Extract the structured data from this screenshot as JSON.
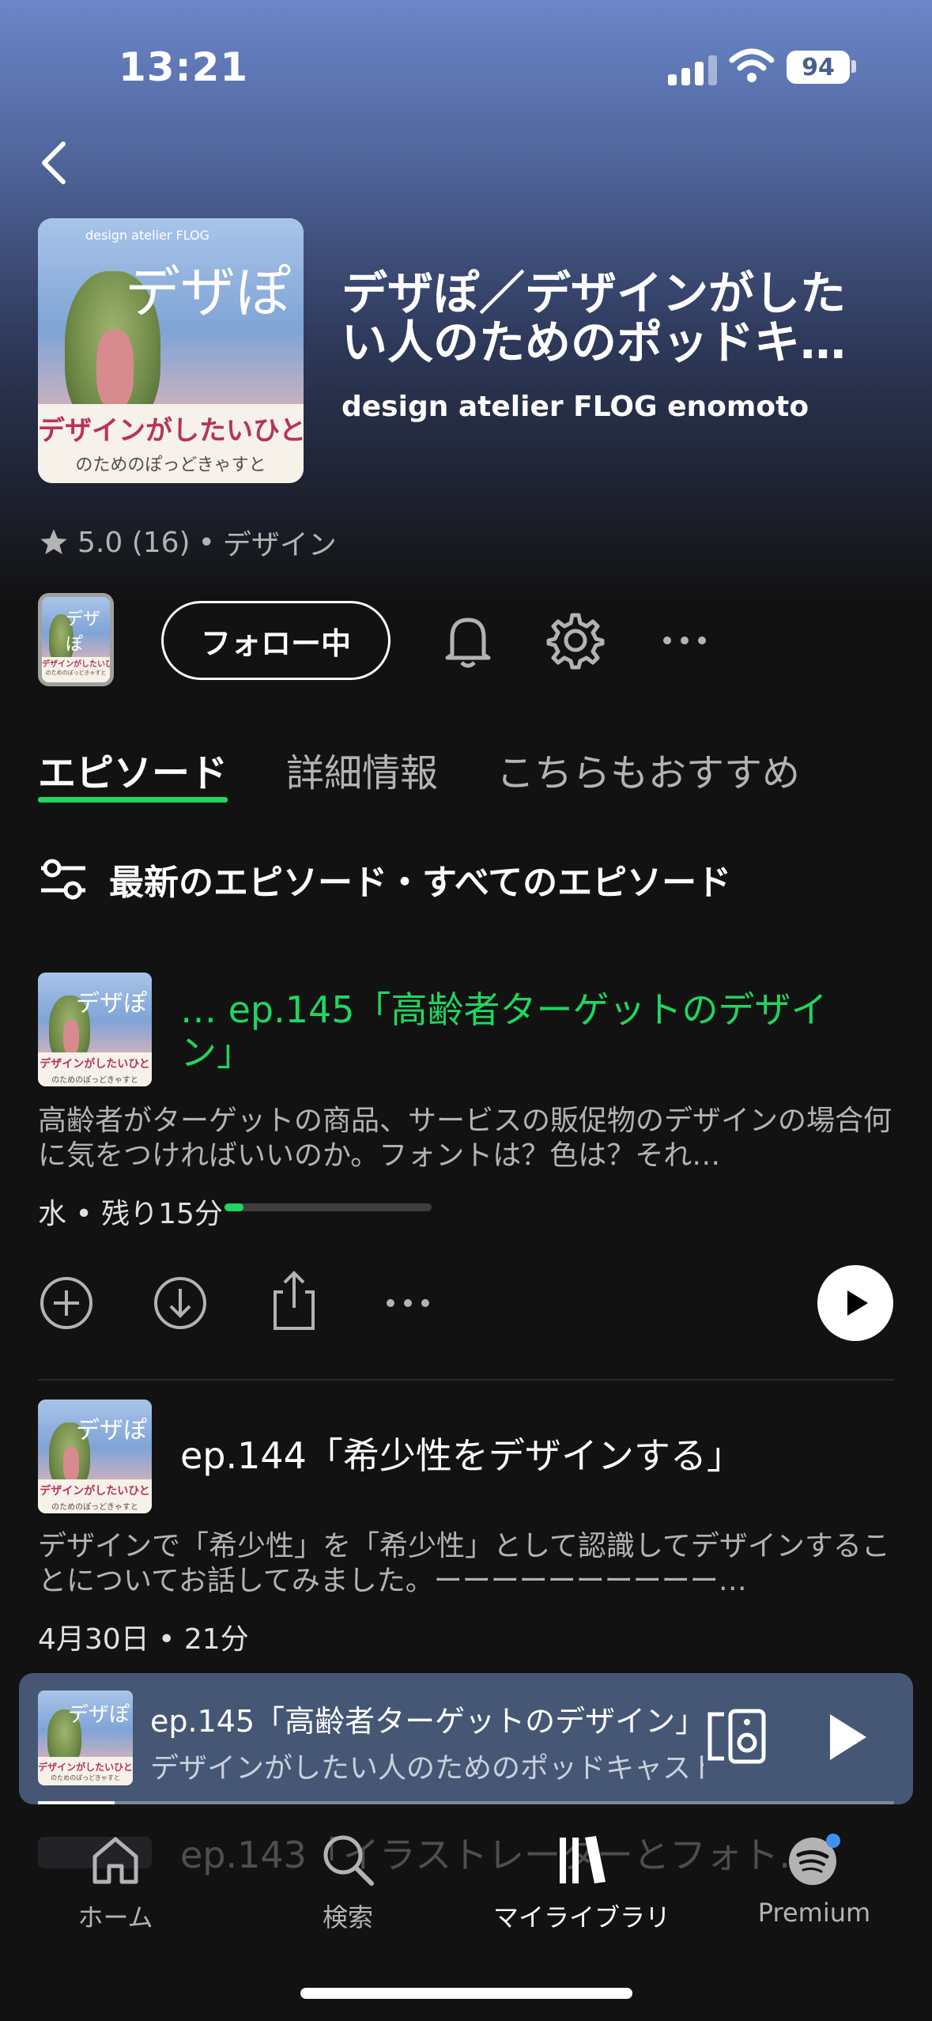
{
  "status_bar": {
    "time": "13:21",
    "battery": "94"
  },
  "podcast": {
    "title": "デザぽ／デザインがしたい人のためのポッドキ…",
    "author": "design atelier FLOG enomoto",
    "rating": "5.0 (16)",
    "separator": "•",
    "category": "デザイン",
    "follow_label": "フォロー中"
  },
  "cover_art": {
    "brand": "design atelier FLOG",
    "main": "デザぽ",
    "line1": "デザインがしたいひと",
    "line2": "のためのぽっどきゃすと"
  },
  "tabs": [
    {
      "label": "エピソード"
    },
    {
      "label": "詳細情報"
    },
    {
      "label": "こちらもおすすめ"
    }
  ],
  "filter_label": "最新のエピソード・すべてのエピソード",
  "episodes": [
    {
      "title": "… ep.145「高齢者ターゲットのデザイン」",
      "description": "高齢者がターゲットの商品、サービスの販促物のデザインの場合何に気をつければいいのか。フォントは？色は？それ…",
      "meta": "水 • 残り15分",
      "progress": 0.09
    },
    {
      "title": "ep.144「希少性をデザインする」",
      "description": "デザインで「希少性」を「希少性」として認識してデザインすることについてお話してみました。ーーーーーーーーーー…",
      "meta": "4月30日 • 21分"
    },
    {
      "title": "ep.143「イラストレーターとフォト…"
    }
  ],
  "mini_player": {
    "title": "ep.145「高齢者ターゲットのデザイン」",
    "subtitle": "デザインがしたい人のためのポッドキャスト"
  },
  "nav": [
    {
      "label": "ホーム"
    },
    {
      "label": "検索"
    },
    {
      "label": "マイライブラリ"
    },
    {
      "label": "Premium"
    }
  ],
  "colors": {
    "accent": "#1ed760",
    "mini_player_bg": "#465775",
    "background": "#121212"
  }
}
